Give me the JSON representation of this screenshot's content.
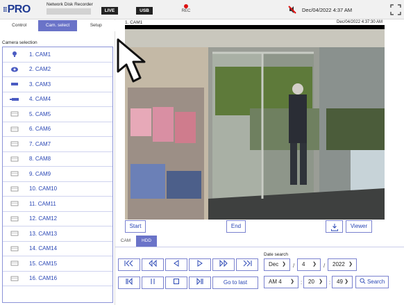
{
  "header": {
    "logo_text": "PRO",
    "logo_dots": "⠿",
    "product_name": "Network Disk Recorder",
    "live_label": "LIVE",
    "usb_label": "USB",
    "rec_label": "REC",
    "datetime": "Dec/04/2022 4:37 AM"
  },
  "tabs": [
    {
      "label": "Control",
      "active": false
    },
    {
      "label": "Cam. select",
      "active": true
    },
    {
      "label": "Setup",
      "active": false
    }
  ],
  "camera_selection": {
    "title": "Camera selection",
    "cameras": [
      {
        "label": "1. CAM1",
        "icon": "dome-camera-icon"
      },
      {
        "label": "2. CAM2",
        "icon": "ptz-camera-icon"
      },
      {
        "label": "3. CAM3",
        "icon": "box-camera-icon"
      },
      {
        "label": "4. CAM4",
        "icon": "bullet-camera-icon"
      },
      {
        "label": "5. CAM5",
        "icon": "no-signal-camera-icon"
      },
      {
        "label": "6. CAM6",
        "icon": "no-signal-camera-icon"
      },
      {
        "label": "7. CAM7",
        "icon": "no-signal-camera-icon"
      },
      {
        "label": "8. CAM8",
        "icon": "no-signal-camera-icon"
      },
      {
        "label": "9. CAM9",
        "icon": "no-signal-camera-icon"
      },
      {
        "label": "10. CAM10",
        "icon": "no-signal-camera-icon"
      },
      {
        "label": "11. CAM11",
        "icon": "no-signal-camera-icon"
      },
      {
        "label": "12. CAM12",
        "icon": "no-signal-camera-icon"
      },
      {
        "label": "13. CAM13",
        "icon": "no-signal-camera-icon"
      },
      {
        "label": "14. CAM14",
        "icon": "no-signal-camera-icon"
      },
      {
        "label": "15. CAM15",
        "icon": "no-signal-camera-icon"
      },
      {
        "label": "16. CAM16",
        "icon": "no-signal-camera-icon"
      }
    ]
  },
  "video": {
    "title": "1. CAM1",
    "datetime": "Dec/04/2022 4:37:30 AM"
  },
  "range": {
    "start_label": "Start",
    "end_label": "End",
    "viewer_label": "Viewer"
  },
  "source_tabs": [
    {
      "label": "CAM",
      "active": false
    },
    {
      "label": "HDD",
      "active": true
    }
  ],
  "playback": {
    "go_to_last_label": "Go to last"
  },
  "date_search": {
    "label": "Date search",
    "month": "Dec",
    "day": "4",
    "year": "2022",
    "hour": "AM 4",
    "minute": "20",
    "second": "49",
    "search_label": "Search"
  },
  "colors": {
    "accent": "#6a73c8",
    "link": "#2a47b5",
    "rec": "#dd1111"
  }
}
